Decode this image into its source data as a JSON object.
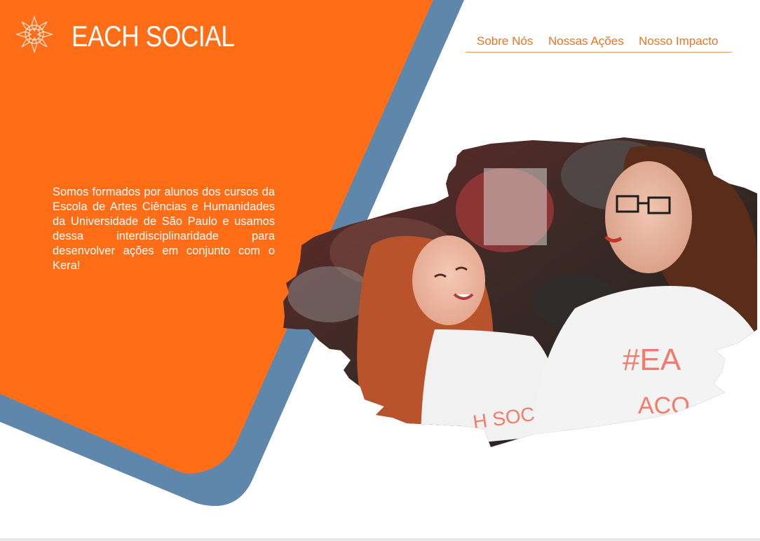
{
  "brand": {
    "name": "EACH SOCIAL",
    "logo_icon": "sun-mandala-icon"
  },
  "nav": {
    "items": [
      "Sobre Nós",
      "Nossas Ações",
      "Nosso Impacto"
    ]
  },
  "hero": {
    "text": "Somos formados por alunos dos cursos da Escola de Artes Ciências e Humanidades da Universidade de São Paulo e usamos dessa interdisciplinaridade para desenvolver ações em conjunto com o Kera!",
    "photo_shirt_text_left": "H SOC",
    "photo_shirt_text_right_1": "#EA",
    "photo_shirt_text_right_2": "ACO"
  },
  "colors": {
    "orange": "#ff6d17",
    "steel_blue": "#5f87ab",
    "nav_text": "#f07320",
    "nav_underline": "#f39a6b"
  }
}
